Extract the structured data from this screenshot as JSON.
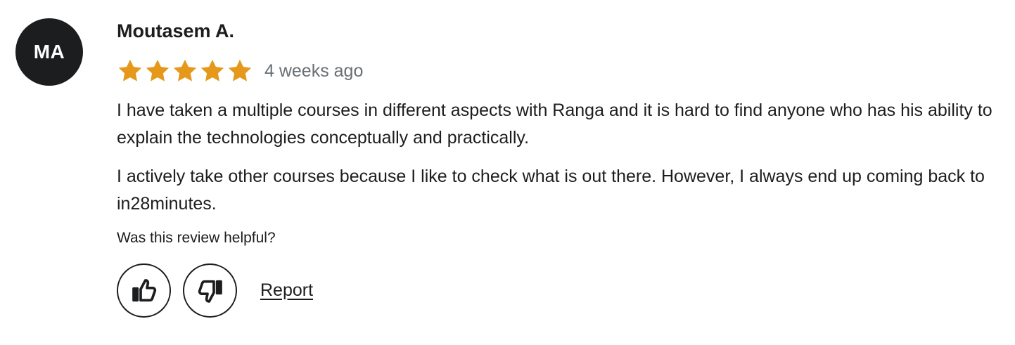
{
  "reviewer": {
    "initials": "MA",
    "name": "Moutasem A."
  },
  "rating": {
    "stars": 5,
    "max_stars": 5,
    "star_color": "#e59819",
    "time_ago": "4 weeks ago"
  },
  "review": {
    "paragraphs": [
      "I have taken a multiple courses in different aspects with Ranga and it is hard to find anyone who has his ability to explain the technologies conceptually and practically.",
      "I actively take other courses because I like to check what is out there. However, I always end up coming back to in28minutes."
    ]
  },
  "feedback": {
    "prompt": "Was this review helpful?",
    "helpful_icon": "thumbs-up-icon",
    "not_helpful_icon": "thumbs-down-icon",
    "report_label": "Report"
  }
}
